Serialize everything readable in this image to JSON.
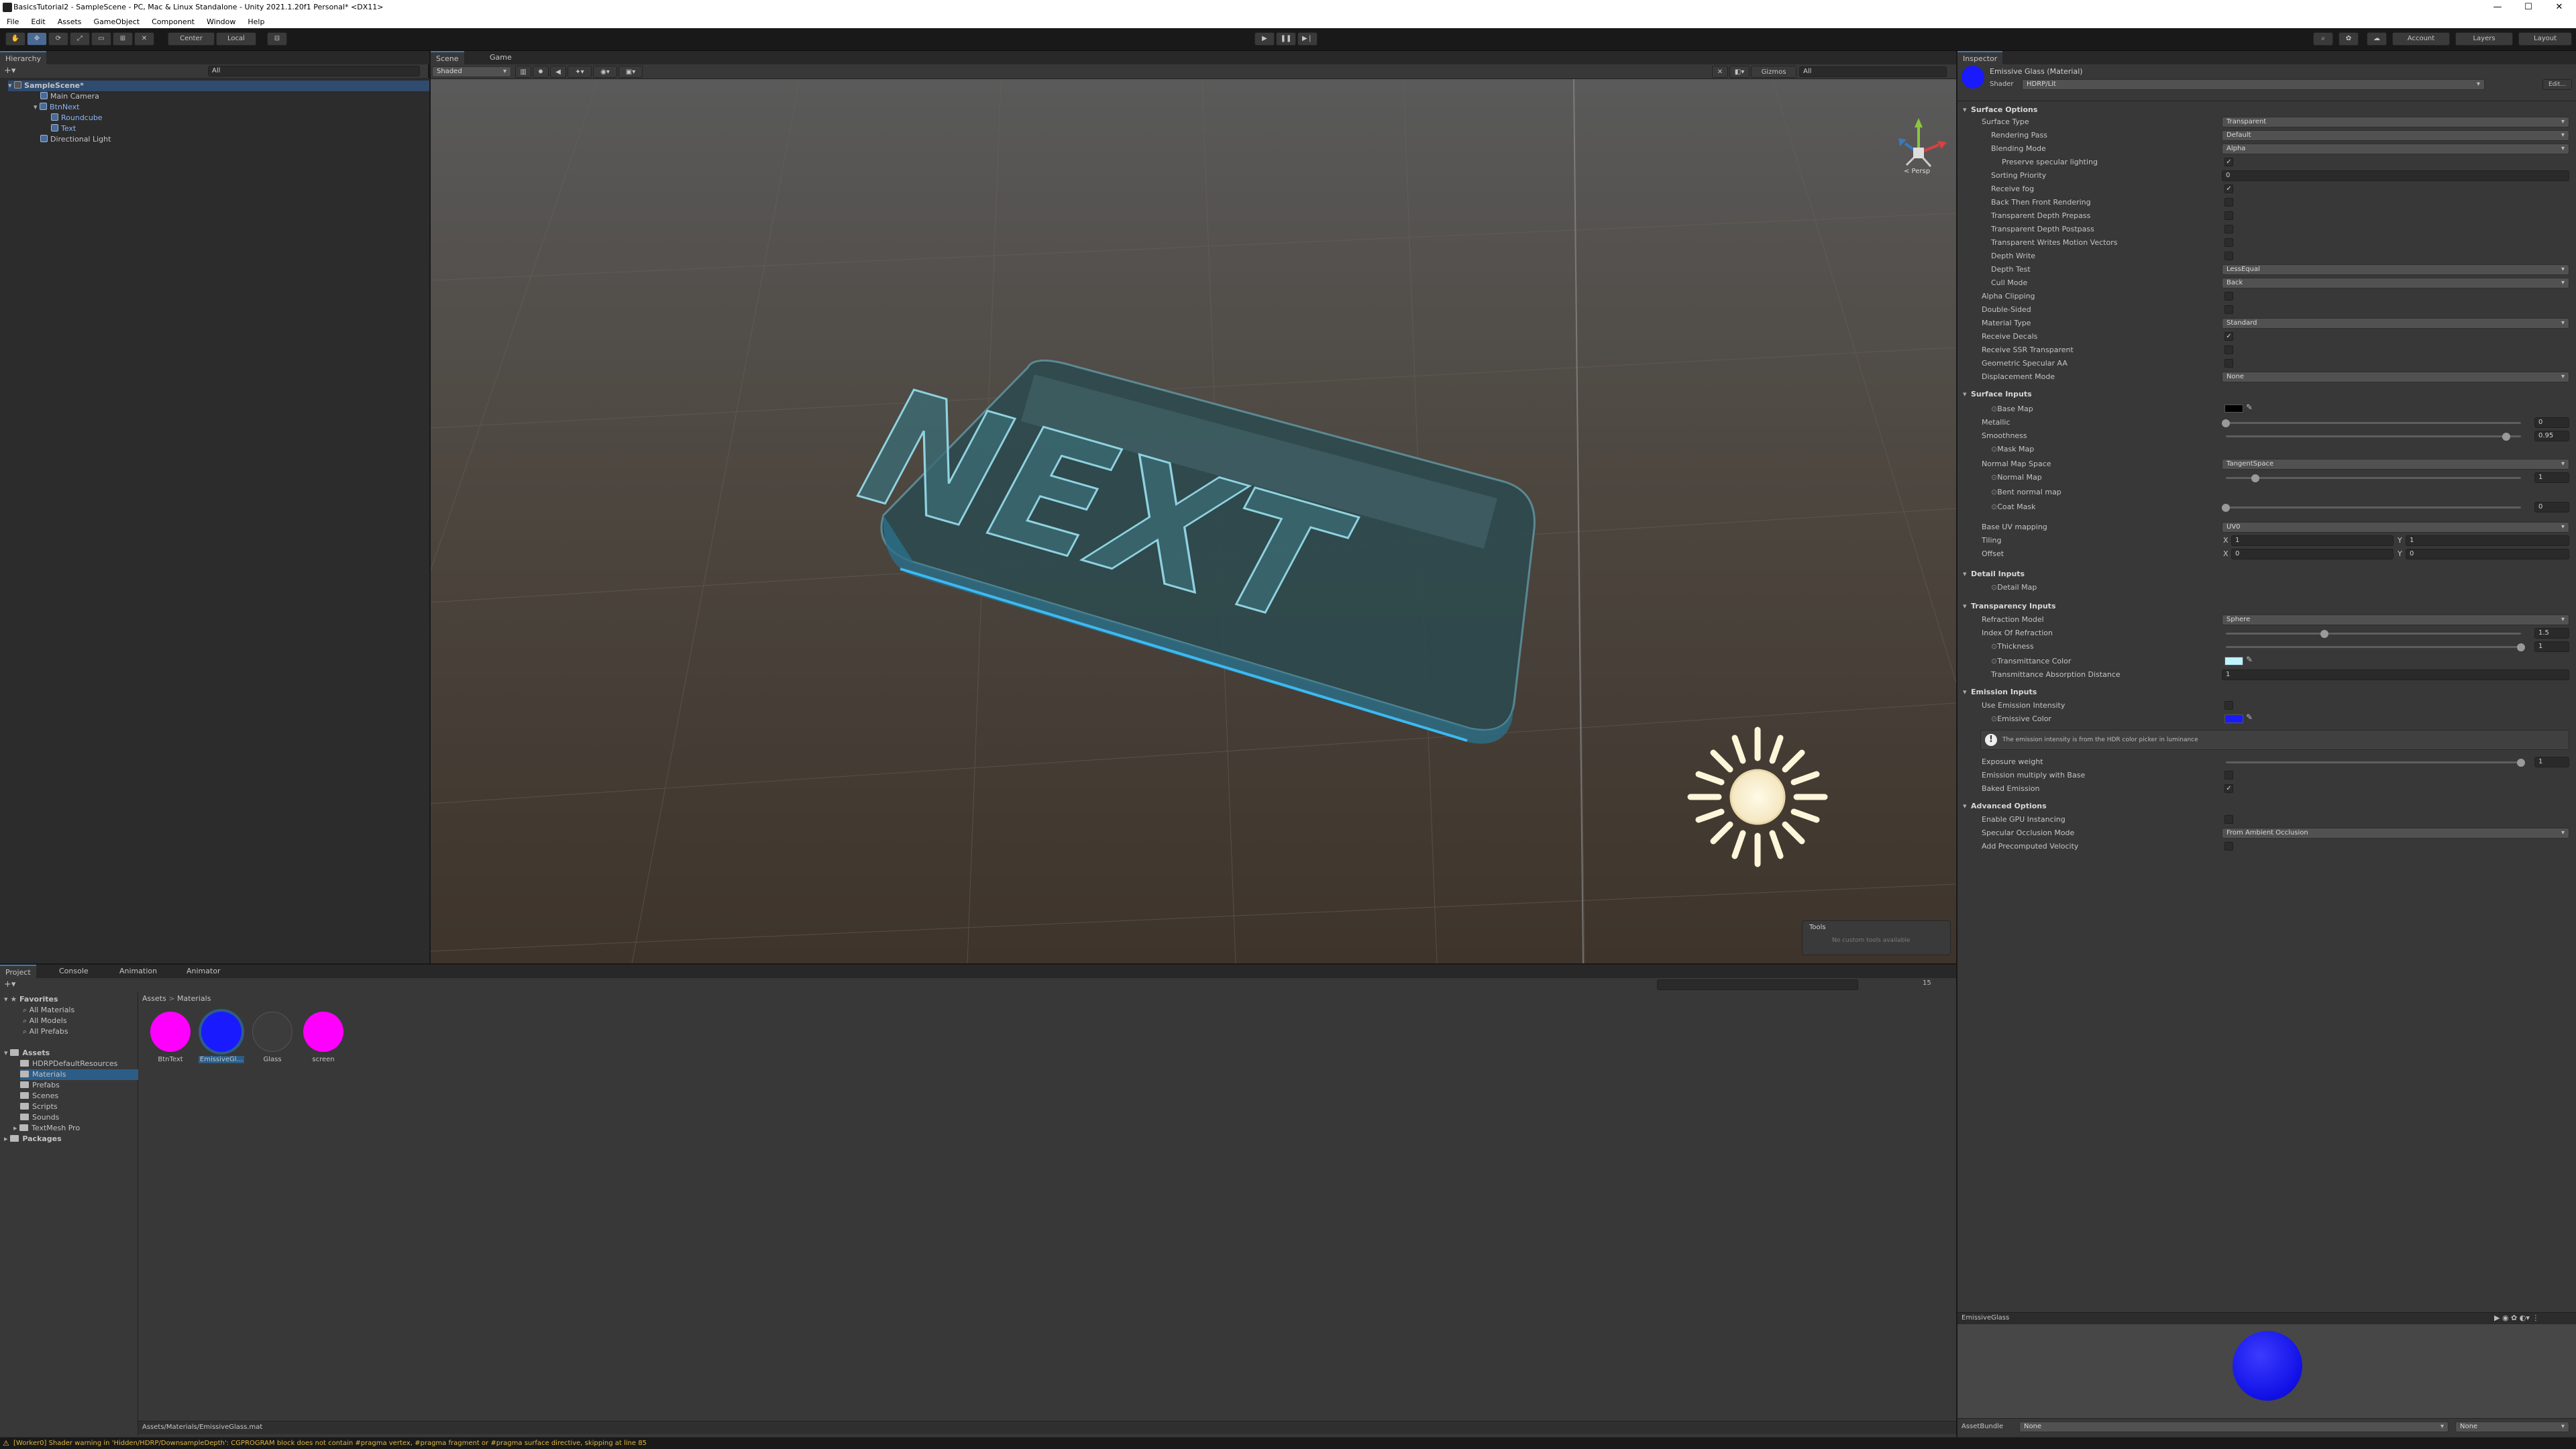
{
  "window": {
    "title": "BasicsTutorial2 - SampleScene - PC, Mac & Linux Standalone - Unity 2021.1.20f1 Personal* <DX11>",
    "min": "—",
    "max": "☐",
    "close": "✕"
  },
  "menu": [
    "File",
    "Edit",
    "Assets",
    "GameObject",
    "Component",
    "Window",
    "Help"
  ],
  "toolbar": {
    "pivot": "Center",
    "space": "Local",
    "play": "▶",
    "pause": "❚❚",
    "step": "▶❘",
    "account": "Account",
    "layers": "Layers",
    "layout": "Layout"
  },
  "hierarchy": {
    "tab": "Hierarchy",
    "search_placeholder": "All",
    "rows": [
      {
        "label": "SampleScene*",
        "indent": 0
      },
      {
        "label": "Main Camera",
        "indent": 2
      },
      {
        "label": "BtnNext",
        "indent": 2
      },
      {
        "label": "Roundcube",
        "indent": 3
      },
      {
        "label": "Text",
        "indent": 3
      },
      {
        "label": "Directional Light",
        "indent": 2
      }
    ]
  },
  "scene": {
    "tabs": [
      "Scene",
      "Game"
    ],
    "shading": "Shaded",
    "gizmos": "Gizmos",
    "search": "All",
    "persp": "< Persp",
    "tools_title": "Tools",
    "tools_text": "No custom tools available",
    "object_text": "NEXT"
  },
  "project": {
    "tabs": [
      "Project",
      "Console",
      "Animation",
      "Animator"
    ],
    "favorites": "Favorites",
    "fav_items": [
      "All Materials",
      "All Models",
      "All Prefabs"
    ],
    "assets_root": "Assets",
    "folders": [
      "HDRPDefaultResources",
      "Materials",
      "Prefabs",
      "Scenes",
      "Scripts",
      "Sounds",
      "TextMesh Pro"
    ],
    "packages": "Packages",
    "breadcrumb_root": "Assets",
    "breadcrumb_sep": ">",
    "breadcrumb_leaf": "Materials",
    "assets": [
      {
        "name": "BtnText",
        "color": "#ff00ff"
      },
      {
        "name": "EmissiveGl...",
        "color": "#1a1aff"
      },
      {
        "name": "Glass",
        "color": "#3c3c3c"
      },
      {
        "name": "screen",
        "color": "#ff00ff"
      }
    ],
    "path": "Assets/Materials/EmissiveGlass.mat",
    "visible_count": "15"
  },
  "console_status": "[Worker0] Shader warning in 'Hidden/HDRP/DownsampleDepth': CGPROGRAM block does not contain #pragma vertex, #pragma fragment or #pragma surface directive, skipping at line 85",
  "inspector": {
    "tab": "Inspector",
    "material_name": "Emissive Glass (Material)",
    "shader_label": "Shader",
    "shader_value": "HDRP/Lit",
    "edit": "Edit...",
    "sections": {
      "surface_options": "Surface Options",
      "surface_inputs": "Surface Inputs",
      "detail_inputs": "Detail Inputs",
      "transparency_inputs": "Transparency Inputs",
      "emission_inputs": "Emission Inputs",
      "advanced_options": "Advanced Options"
    },
    "surface_type": {
      "label": "Surface Type",
      "value": "Transparent"
    },
    "rendering_pass": {
      "label": "Rendering Pass",
      "value": "Default"
    },
    "blending_mode": {
      "label": "Blending Mode",
      "value": "Alpha"
    },
    "preserve_specular": "Preserve specular lighting",
    "sorting_priority": {
      "label": "Sorting Priority",
      "value": "0"
    },
    "receive_fog": "Receive fog",
    "back_then_front": "Back Then Front Rendering",
    "depth_prepass": "Transparent Depth Prepass",
    "depth_postpass": "Transparent Depth Postpass",
    "writes_motion": "Transparent Writes Motion Vectors",
    "depth_write": "Depth Write",
    "depth_test": {
      "label": "Depth Test",
      "value": "LessEqual"
    },
    "cull_mode": {
      "label": "Cull Mode",
      "value": "Back"
    },
    "alpha_clipping": "Alpha Clipping",
    "double_sided": "Double-Sided",
    "material_type": {
      "label": "Material Type",
      "value": "Standard"
    },
    "receive_decals": "Receive Decals",
    "receive_ssr": "Receive SSR Transparent",
    "geometric_aa": "Geometric Specular AA",
    "displacement": {
      "label": "Displacement Mode",
      "value": "None"
    },
    "base_map": "Base Map",
    "metallic": {
      "label": "Metallic",
      "value": "0",
      "level": 0
    },
    "smoothness": {
      "label": "Smoothness",
      "value": "0.95",
      "level": 0.95
    },
    "mask_map": "Mask Map",
    "normal_map_space": {
      "label": "Normal Map Space",
      "value": "TangentSpace"
    },
    "normal_map": {
      "label": "Normal Map",
      "value": "1",
      "level": 0.1
    },
    "bent_normal": "Bent normal map",
    "coat_mask": {
      "label": "Coat Mask",
      "value": "0",
      "level": 0
    },
    "base_uv": {
      "label": "Base UV mapping",
      "value": "UV0"
    },
    "tiling": {
      "label": "Tiling",
      "x": "1",
      "y": "1",
      "xl": "X",
      "yl": "Y"
    },
    "offset": {
      "label": "Offset",
      "x": "0",
      "y": "0",
      "xl": "X",
      "yl": "Y"
    },
    "detail_map": "Detail Map",
    "refraction_model": {
      "label": "Refraction Model",
      "value": "Sphere"
    },
    "ior": {
      "label": "Index Of Refraction",
      "value": "1.5",
      "level": 0.333
    },
    "thickness": {
      "label": "Thickness",
      "value": "1",
      "level": 1
    },
    "transmittance_color": "Transmittance Color",
    "absorption_distance": {
      "label": "Transmittance Absorption Distance",
      "value": "1"
    },
    "use_emission_intensity": "Use Emission Intensity",
    "emissive_color": "Emissive Color",
    "emission_help": "The emission intensity is from the HDR color picker in luminance",
    "exposure_weight": {
      "label": "Exposure weight",
      "value": "1",
      "level": 1
    },
    "emission_multiply": "Emission multiply with Base",
    "baked_emission": "Baked Emission",
    "gpu_instancing": "Enable GPU Instancing",
    "specular_occlusion": {
      "label": "Specular Occlusion Mode",
      "value": "From Ambient Occlusion"
    },
    "precomputed_velocity": "Add Precomputed Velocity",
    "preview_name": "EmissiveGlass",
    "assetbundle_label": "AssetBundle",
    "assetbundle_value": "None",
    "assetbundle_variant": "None"
  },
  "colors": {
    "emissive": "#1a1aff",
    "transmittance": "#bff3ff",
    "glass_edge": "#3fc3ff",
    "accent": "#3a79bb"
  }
}
